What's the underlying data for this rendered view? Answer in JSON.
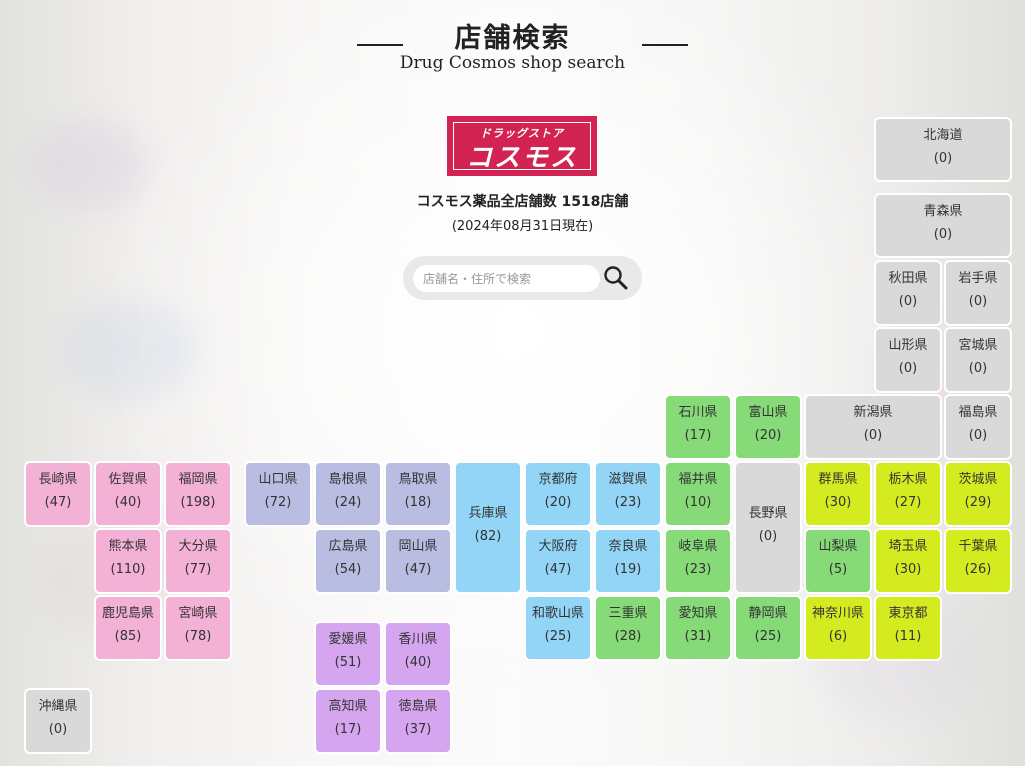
{
  "header": {
    "title_jp": "店舗検索",
    "title_en": "Drug Cosmos shop search"
  },
  "logo": {
    "sub": "ドラッグストア",
    "main": "コスモス",
    "brand_color": "#d22352"
  },
  "summary": {
    "store_count": "コスモス薬品全店舗数 1518店舗",
    "as_of": "(2024年08月31日現在)"
  },
  "search": {
    "placeholder": "店舗名・住所で検索",
    "value": "",
    "button_icon": "search-icon"
  },
  "region_colors": {
    "none": "#d9d9d9",
    "kyushu": "#f3b1d6",
    "chugoku": "#b9bde2",
    "shikoku": "#d5a6ef",
    "kinki": "#92d5f6",
    "chubu": "#86da78",
    "kanto": "#d4ec1f"
  },
  "prefectures": [
    {
      "id": "hokkaido",
      "name": "北海道",
      "count": "(0)",
      "region": "none"
    },
    {
      "id": "aomori",
      "name": "青森県",
      "count": "(0)",
      "region": "none"
    },
    {
      "id": "akita",
      "name": "秋田県",
      "count": "(0)",
      "region": "none"
    },
    {
      "id": "iwate",
      "name": "岩手県",
      "count": "(0)",
      "region": "none"
    },
    {
      "id": "yamagata",
      "name": "山形県",
      "count": "(0)",
      "region": "none"
    },
    {
      "id": "miyagi",
      "name": "宮城県",
      "count": "(0)",
      "region": "none"
    },
    {
      "id": "ishikawa",
      "name": "石川県",
      "count": "(17)",
      "region": "chubu"
    },
    {
      "id": "toyama",
      "name": "富山県",
      "count": "(20)",
      "region": "chubu"
    },
    {
      "id": "niigata",
      "name": "新潟県",
      "count": "(0)",
      "region": "none"
    },
    {
      "id": "fukushima",
      "name": "福島県",
      "count": "(0)",
      "region": "none"
    },
    {
      "id": "nagasaki",
      "name": "長崎県",
      "count": "(47)",
      "region": "kyushu"
    },
    {
      "id": "saga",
      "name": "佐賀県",
      "count": "(40)",
      "region": "kyushu"
    },
    {
      "id": "fukuoka",
      "name": "福岡県",
      "count": "(198)",
      "region": "kyushu"
    },
    {
      "id": "yamaguchi",
      "name": "山口県",
      "count": "(72)",
      "region": "chugoku"
    },
    {
      "id": "shimane",
      "name": "島根県",
      "count": "(24)",
      "region": "chugoku"
    },
    {
      "id": "tottori",
      "name": "鳥取県",
      "count": "(18)",
      "region": "chugoku"
    },
    {
      "id": "hyogo",
      "name": "兵庫県",
      "count": "(82)",
      "region": "kinki"
    },
    {
      "id": "kyoto",
      "name": "京都府",
      "count": "(20)",
      "region": "kinki"
    },
    {
      "id": "shiga",
      "name": "滋賀県",
      "count": "(23)",
      "region": "kinki"
    },
    {
      "id": "fukui",
      "name": "福井県",
      "count": "(10)",
      "region": "chubu"
    },
    {
      "id": "nagano",
      "name": "長野県",
      "count": "(0)",
      "region": "none"
    },
    {
      "id": "gunma",
      "name": "群馬県",
      "count": "(30)",
      "region": "kanto"
    },
    {
      "id": "tochigi",
      "name": "栃木県",
      "count": "(27)",
      "region": "kanto"
    },
    {
      "id": "ibaraki",
      "name": "茨城県",
      "count": "(29)",
      "region": "kanto"
    },
    {
      "id": "kumamoto",
      "name": "熊本県",
      "count": "(110)",
      "region": "kyushu"
    },
    {
      "id": "oita",
      "name": "大分県",
      "count": "(77)",
      "region": "kyushu"
    },
    {
      "id": "hiroshima",
      "name": "広島県",
      "count": "(54)",
      "region": "chugoku"
    },
    {
      "id": "okayama",
      "name": "岡山県",
      "count": "(47)",
      "region": "chugoku"
    },
    {
      "id": "osaka",
      "name": "大阪府",
      "count": "(47)",
      "region": "kinki"
    },
    {
      "id": "nara",
      "name": "奈良県",
      "count": "(19)",
      "region": "kinki"
    },
    {
      "id": "gifu",
      "name": "岐阜県",
      "count": "(23)",
      "region": "chubu"
    },
    {
      "id": "yamanashi",
      "name": "山梨県",
      "count": "(5)",
      "region": "chubu"
    },
    {
      "id": "saitama",
      "name": "埼玉県",
      "count": "(30)",
      "region": "kanto"
    },
    {
      "id": "chiba",
      "name": "千葉県",
      "count": "(26)",
      "region": "kanto"
    },
    {
      "id": "kagoshima",
      "name": "鹿児島県",
      "count": "(85)",
      "region": "kyushu"
    },
    {
      "id": "miyazaki",
      "name": "宮崎県",
      "count": "(78)",
      "region": "kyushu"
    },
    {
      "id": "wakayama",
      "name": "和歌山県",
      "count": "(25)",
      "region": "kinki"
    },
    {
      "id": "mie",
      "name": "三重県",
      "count": "(28)",
      "region": "chubu"
    },
    {
      "id": "aichi",
      "name": "愛知県",
      "count": "(31)",
      "region": "chubu"
    },
    {
      "id": "shizuoka",
      "name": "静岡県",
      "count": "(25)",
      "region": "chubu"
    },
    {
      "id": "kanagawa",
      "name": "神奈川県",
      "count": "(6)",
      "region": "kanto"
    },
    {
      "id": "tokyo",
      "name": "東京都",
      "count": "(11)",
      "region": "kanto"
    },
    {
      "id": "ehime",
      "name": "愛媛県",
      "count": "(51)",
      "region": "shikoku"
    },
    {
      "id": "kagawa",
      "name": "香川県",
      "count": "(40)",
      "region": "shikoku"
    },
    {
      "id": "kochi",
      "name": "高知県",
      "count": "(17)",
      "region": "shikoku"
    },
    {
      "id": "tokushima",
      "name": "徳島県",
      "count": "(37)",
      "region": "shikoku"
    },
    {
      "id": "okinawa",
      "name": "沖縄県",
      "count": "(0)",
      "region": "none"
    }
  ]
}
